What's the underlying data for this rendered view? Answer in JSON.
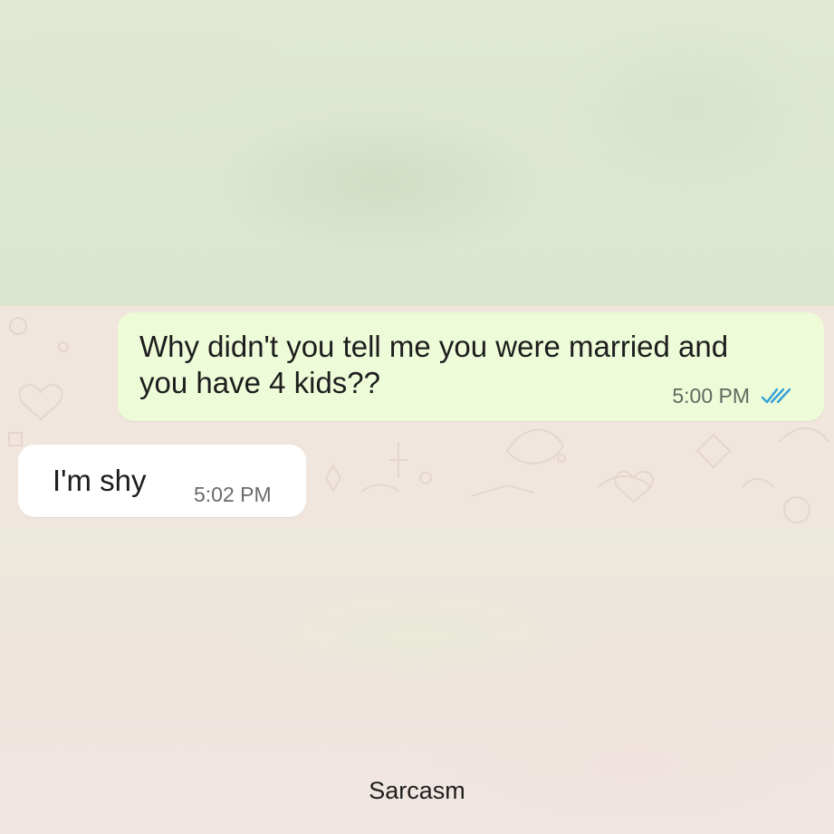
{
  "conversation": {
    "outgoing": {
      "text": "Why didn't you tell me you were married and you have 4 kids??",
      "time": "5:00 PM",
      "status_icon": "double-check-icon",
      "status_color": "#34a0d8"
    },
    "incoming": {
      "text": "I'm shy",
      "time": "5:02 PM"
    }
  },
  "caption": "Sarcasm",
  "colors": {
    "outgoing_bubble": "#eefbd8",
    "incoming_bubble": "#ffffff",
    "chat_background": "#f1e6dd"
  }
}
